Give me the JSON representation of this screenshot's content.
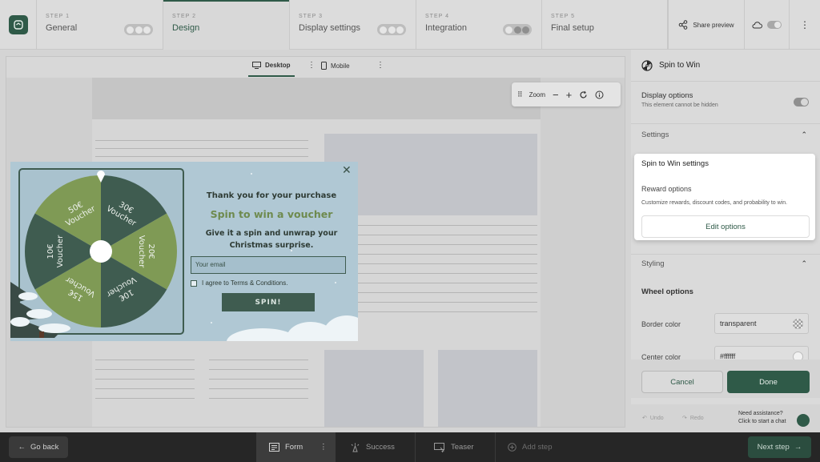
{
  "steps": [
    {
      "num": "STEP 1",
      "name": "General"
    },
    {
      "num": "STEP 2",
      "name": "Design"
    },
    {
      "num": "STEP 3",
      "name": "Display settings"
    },
    {
      "num": "STEP 4",
      "name": "Integration"
    },
    {
      "num": "STEP 5",
      "name": "Final setup"
    }
  ],
  "header": {
    "share_label": "Share preview"
  },
  "device_tabs": {
    "desktop": "Desktop",
    "mobile": "Mobile"
  },
  "zoom": {
    "label": "Zoom"
  },
  "popup": {
    "title": "Thank you for your purchase",
    "subtitle": "Spin to win a voucher",
    "body": "Give it a spin and unwrap your Christmas surprise.",
    "email_placeholder": "Your email",
    "terms": "I agree to Terms & Conditions.",
    "spin_button": "SPIN!",
    "wheel_segments": [
      "30€ Voucher",
      "20€ Voucher",
      "10€ Voucher",
      "15€ Voucher",
      "10€ Voucher",
      "50€ Voucher"
    ]
  },
  "panel": {
    "title": "Spin to Win",
    "display_options": "Display options",
    "display_options_note": "This element cannot be hidden",
    "settings": "Settings",
    "card_title": "Spin to Win settings",
    "reward_options": "Reward options",
    "reward_desc": "Customize rewards, discount codes, and probability to win.",
    "edit_options": "Edit options",
    "styling": "Styling",
    "wheel_options": "Wheel options",
    "border_color_label": "Border color",
    "border_color_value": "transparent",
    "center_color_label": "Center color",
    "center_color_value": "#ffffff",
    "cancel": "Cancel",
    "done": "Done",
    "undo": "Undo",
    "redo": "Redo",
    "need_assistance": "Need assistance?",
    "start_chat": "Click to start a chat"
  },
  "bottom": {
    "go_back": "Go back",
    "tabs": [
      "Form",
      "Success",
      "Teaser",
      "Add step"
    ],
    "next_step": "Next step"
  },
  "colors": {
    "brand": "#2f5a48",
    "wheel_light": "#7f9a55",
    "wheel_dark": "#3f5c50"
  }
}
